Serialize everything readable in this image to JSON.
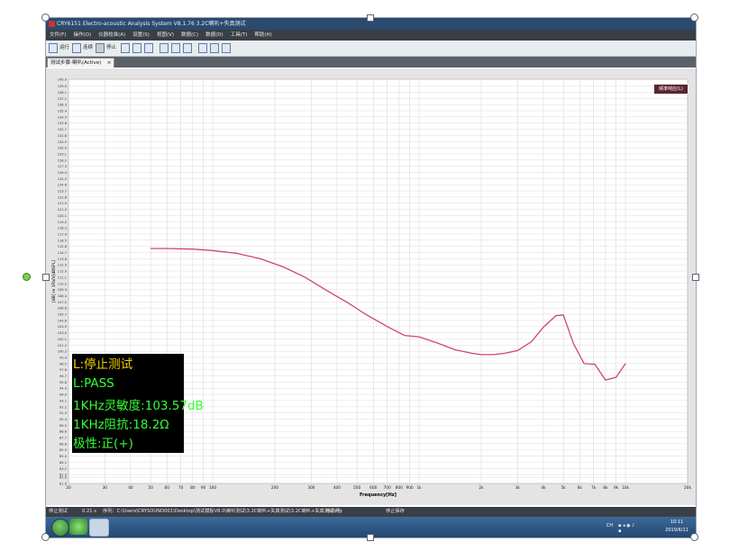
{
  "window": {
    "title": "CRY6151 Electro-acoustic Analysis System  V8.1.76 3.2C喇叭+失真测试"
  },
  "menu": [
    "文件(F)",
    "操作(O)",
    "仪器校准(A)",
    "设置(S)",
    "视图(V)",
    "数据(C)",
    "数据(D)",
    "工具(T)",
    "帮助(H)"
  ],
  "toolbar": {
    "run_label": "运行",
    "continue_label": "连续",
    "stop_label": "停止"
  },
  "tab": {
    "label": "测试步骤-喇叭(Active)",
    "close": "×"
  },
  "legend_label": "频率响应(L)",
  "infobox": {
    "line1": "L:停止测试",
    "line2": "L:PASS",
    "line3": "1KHz灵敏度:103.57dB",
    "line4": "1KHz阻抗:18.2Ω",
    "line5": "极性:正(+)"
  },
  "colors": {
    "curve": "#d0456e",
    "info_title": "#f0d000",
    "info_text": "#33ff33"
  },
  "statusbar": {
    "state": "停止测试",
    "time": "0.21 s",
    "sequence": "序列：C:\\Users\\CRYSOUND001\\Desktop\\测试模板V8.0\\喇叭测试\\3.2C喇叭+失真测试\\3.2C喇叭+失真测试.cry",
    "seq_no": "序列号：",
    "stop_save": "停止保存"
  },
  "tray": {
    "lang": "CH",
    "time": "10:11",
    "date": "2019/6/11"
  },
  "chart_data": {
    "type": "line",
    "xlabel": "Frequency[Hz]",
    "ylabel": "[dB] re 1Pa/V[dBSPL]",
    "xscale": "log",
    "xlim": [
      20,
      20000
    ],
    "ylim": [
      81.0,
      140.0
    ],
    "x_ticks": [
      20,
      30,
      40,
      50,
      60,
      70,
      80,
      90,
      100,
      200,
      300,
      400,
      500,
      600,
      700,
      800,
      900,
      1000,
      2000,
      3000,
      4000,
      5000,
      6000,
      7000,
      8000,
      9000,
      10000,
      20000
    ],
    "x_tick_labels": [
      "20",
      "30",
      "40",
      "50",
      "60",
      "70",
      "80",
      "90",
      "100",
      "200",
      "300",
      "400",
      "500",
      "600",
      "700",
      "800",
      "900",
      "1k",
      "2k",
      "3k",
      "4k",
      "5k",
      "6k",
      "7k",
      "8k",
      "9k",
      "10k",
      "20k"
    ],
    "y_ticks": [
      81.0,
      81.9,
      82.3,
      83.2,
      84.1,
      85.0,
      85.9,
      86.8,
      87.7,
      88.6,
      89.5,
      90.4,
      91.3,
      92.2,
      93.1,
      94.0,
      94.9,
      95.8,
      96.7,
      97.6,
      98.5,
      99.4,
      100.3,
      101.2,
      102.1,
      103.0,
      103.9,
      104.8,
      105.7,
      106.6,
      107.5,
      108.4,
      109.3,
      110.2,
      111.1,
      112.0,
      112.9,
      113.8,
      114.7,
      115.6,
      116.5,
      117.4,
      118.3,
      119.2,
      120.1,
      121.0,
      121.9,
      122.8,
      123.7,
      124.6,
      125.5,
      126.4,
      127.3,
      128.2,
      129.1,
      130.0,
      130.9,
      131.8,
      132.7,
      133.6,
      134.5,
      135.4,
      136.3,
      137.2,
      138.1,
      139.0,
      140.0
    ],
    "grid": true,
    "legend": "top-right",
    "series": [
      {
        "name": "频率响应(L)",
        "x": [
          50,
          60,
          80,
          100,
          130,
          170,
          220,
          280,
          350,
          450,
          550,
          700,
          850,
          1000,
          1200,
          1500,
          1800,
          2000,
          2300,
          2600,
          3000,
          3500,
          4000,
          4600,
          5000,
          5600,
          6300,
          7100,
          8000,
          9000,
          10000
        ],
        "y": [
          115.3,
          115.3,
          115.2,
          115.0,
          114.6,
          113.8,
          112.6,
          111.1,
          109.3,
          107.4,
          105.7,
          103.9,
          102.6,
          102.4,
          101.6,
          100.5,
          100.0,
          99.8,
          99.8,
          100.0,
          100.4,
          101.7,
          103.8,
          105.5,
          105.6,
          101.4,
          98.5,
          98.4,
          96.1,
          96.5,
          98.5
        ]
      }
    ]
  }
}
